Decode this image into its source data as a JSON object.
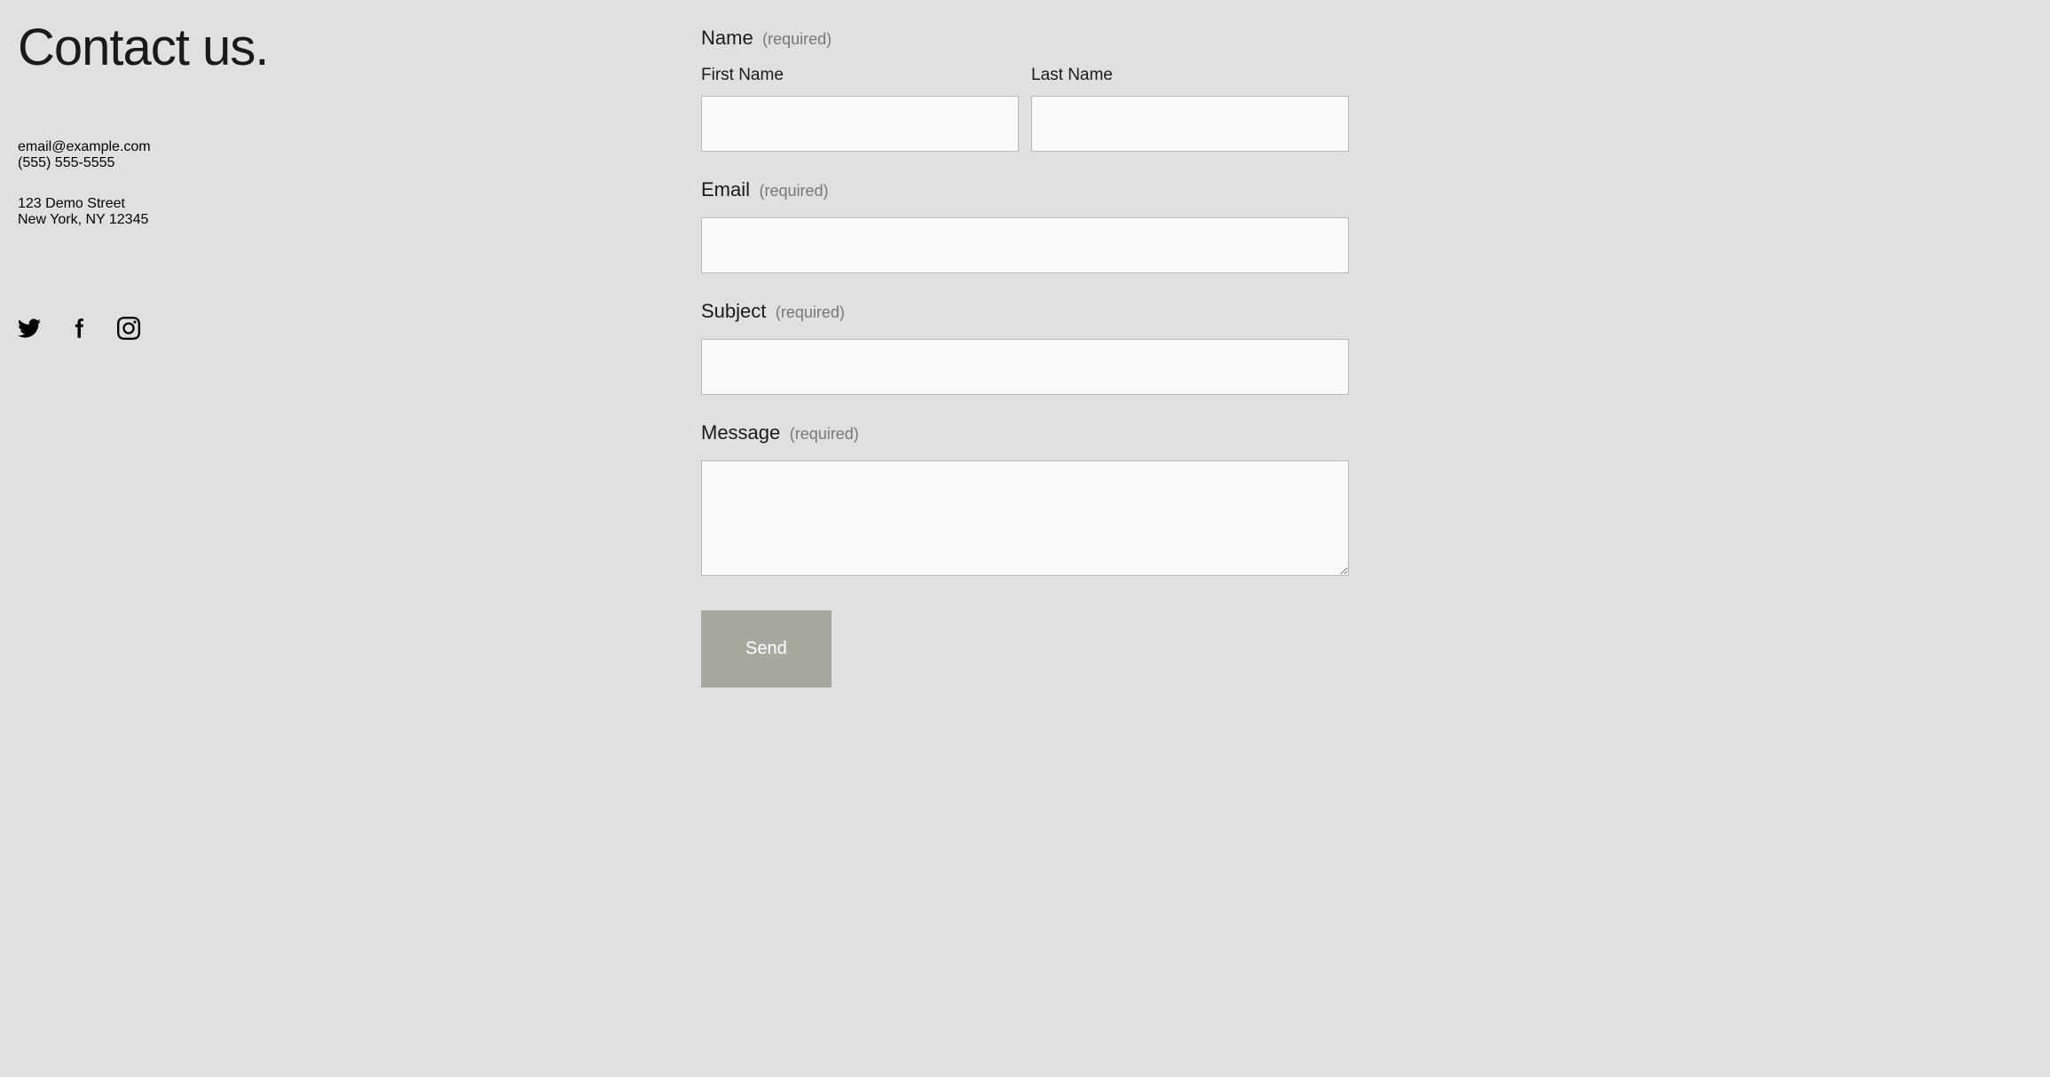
{
  "heading": "Contact us.",
  "contact": {
    "email": "email@example.com",
    "phone": "(555) 555-5555",
    "address_line1": "123 Demo Street",
    "address_line2": "New York, NY 12345"
  },
  "form": {
    "name_label": "Name",
    "first_name_label": "First Name",
    "last_name_label": "Last Name",
    "email_label": "Email",
    "subject_label": "Subject",
    "message_label": "Message",
    "required_text": "(required)",
    "send_button": "Send"
  }
}
